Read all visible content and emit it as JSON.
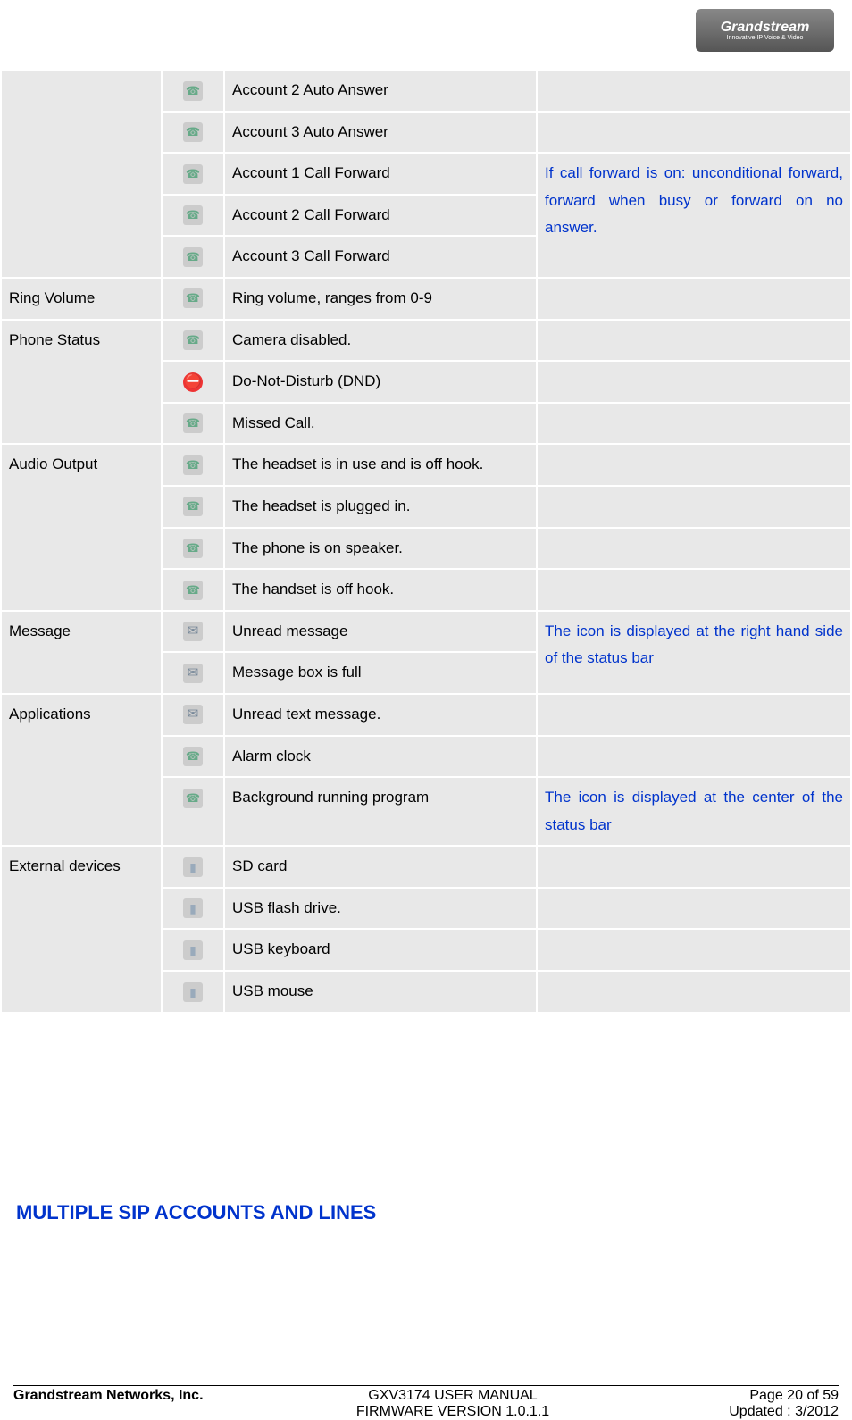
{
  "logo": {
    "name": "Grandstream",
    "tagline": "Innovative IP Voice & Video"
  },
  "table": {
    "groups": [
      {
        "label": "",
        "rows": [
          {
            "icon": "phone-2-auto-answer-icon",
            "desc": "Account 2 Auto Answer",
            "note": ""
          },
          {
            "icon": "phone-3-auto-answer-icon",
            "desc": "Account 3 Auto Answer",
            "note": ""
          },
          {
            "icon": "phone-1-call-forward-icon",
            "desc": "Account 1 Call Forward",
            "note_start": true
          },
          {
            "icon": "phone-2-call-forward-icon",
            "desc": "Account 2 Call Forward"
          },
          {
            "icon": "phone-3-call-forward-icon",
            "desc": "Account 3 Call Forward"
          }
        ],
        "note_span": "If call forward is on: unconditional forward, forward when busy or forward on no answer."
      },
      {
        "label": "Ring Volume",
        "rows": [
          {
            "icon": "ring-volume-icon",
            "desc": "Ring volume, ranges from 0-9",
            "note": ""
          }
        ]
      },
      {
        "label": "Phone Status",
        "rows": [
          {
            "icon": "camera-disabled-icon",
            "desc": "Camera disabled.",
            "note": ""
          },
          {
            "icon": "dnd-icon",
            "desc": "Do-Not-Disturb (DND)",
            "note": ""
          },
          {
            "icon": "missed-call-icon",
            "desc": "Missed Call.",
            "note": ""
          }
        ]
      },
      {
        "label": "Audio Output",
        "rows": [
          {
            "icon": "headset-offhook-icon",
            "desc": "The headset is in use and is off hook.",
            "note": ""
          },
          {
            "icon": "headset-plugged-icon",
            "desc": "The headset is plugged in.",
            "note": ""
          },
          {
            "icon": "speaker-icon",
            "desc": "The phone is on speaker.",
            "note": ""
          },
          {
            "icon": "handset-offhook-icon",
            "desc": "The handset is off hook.",
            "note": ""
          }
        ]
      },
      {
        "label": "Message",
        "rows": [
          {
            "icon": "unread-message-icon",
            "desc": "Unread message",
            "note_start": true
          },
          {
            "icon": "message-full-icon",
            "desc": "Message box is full"
          }
        ],
        "note_span": "The icon is displayed at the right hand side of the status bar"
      },
      {
        "label": "Applications",
        "rows": [
          {
            "icon": "unread-text-icon",
            "desc": "Unread text message.",
            "note": ""
          },
          {
            "icon": "alarm-clock-icon",
            "desc": "Alarm clock",
            "note": ""
          },
          {
            "icon": "background-app-icon",
            "desc": "Background running program",
            "note": "The icon is displayed at the center of the status bar",
            "note_blue": true
          }
        ]
      },
      {
        "label": "External devices",
        "rows": [
          {
            "icon": "sd-card-icon",
            "desc": "SD card",
            "note": ""
          },
          {
            "icon": "usb-drive-icon",
            "desc": "USB flash drive.",
            "note": ""
          },
          {
            "icon": "usb-keyboard-icon",
            "desc": "USB keyboard",
            "note": ""
          },
          {
            "icon": "usb-mouse-icon",
            "desc": "USB mouse",
            "note": ""
          }
        ]
      }
    ]
  },
  "section_heading": "MULTIPLE SIP ACCOUNTS AND LINES",
  "footer": {
    "company": "Grandstream Networks, Inc.",
    "title": "GXV3174 USER MANUAL",
    "firmware": "FIRMWARE VERSION 1.0.1.1",
    "page": "Page 20 of 59",
    "updated": "Updated : 3/2012"
  }
}
